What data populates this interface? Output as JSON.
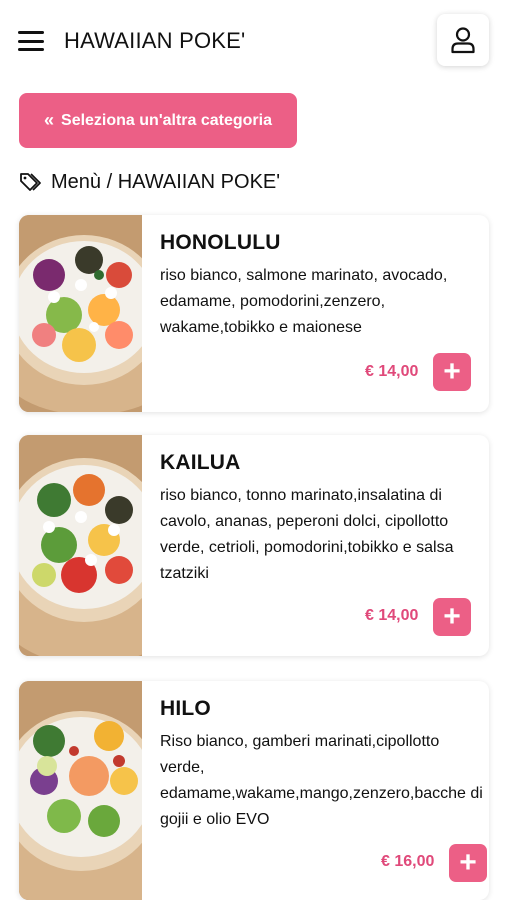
{
  "header": {
    "title": "HAWAIIAN POKE'",
    "menu_icon": "hamburger-menu-icon",
    "user_icon": "user-icon"
  },
  "category_button": {
    "label": "Seleziona un'altra categoria",
    "icon": "double-chevron-left-icon"
  },
  "breadcrumb": {
    "icon": "tags-icon",
    "text": "Menù / HAWAIIAN POKE'"
  },
  "colors": {
    "accent": "#ec5f86",
    "price": "#e0497a"
  },
  "products": [
    {
      "name": "HONOLULU",
      "description": "riso bianco, salmone marinato, avocado, edamame, pomodorini,zenzero, wakame,tobikko e maionese",
      "price": "€ 14,00",
      "add_label": "+"
    },
    {
      "name": "KAILUA",
      "description": "riso bianco, tonno marinato,insalatina di cavolo, ananas, peperoni dolci, cipollotto verde, cetrioli, pomodorini,tobikko e salsa tzatziki",
      "price": "€ 14,00",
      "add_label": "+"
    },
    {
      "name": "HILO",
      "description": "Riso bianco, gamberi marinati,cipollotto verde, edamame,wakame,mango,zenzero,bacche di gojii e olio EVO",
      "price": "€ 16,00",
      "add_label": "+"
    }
  ]
}
